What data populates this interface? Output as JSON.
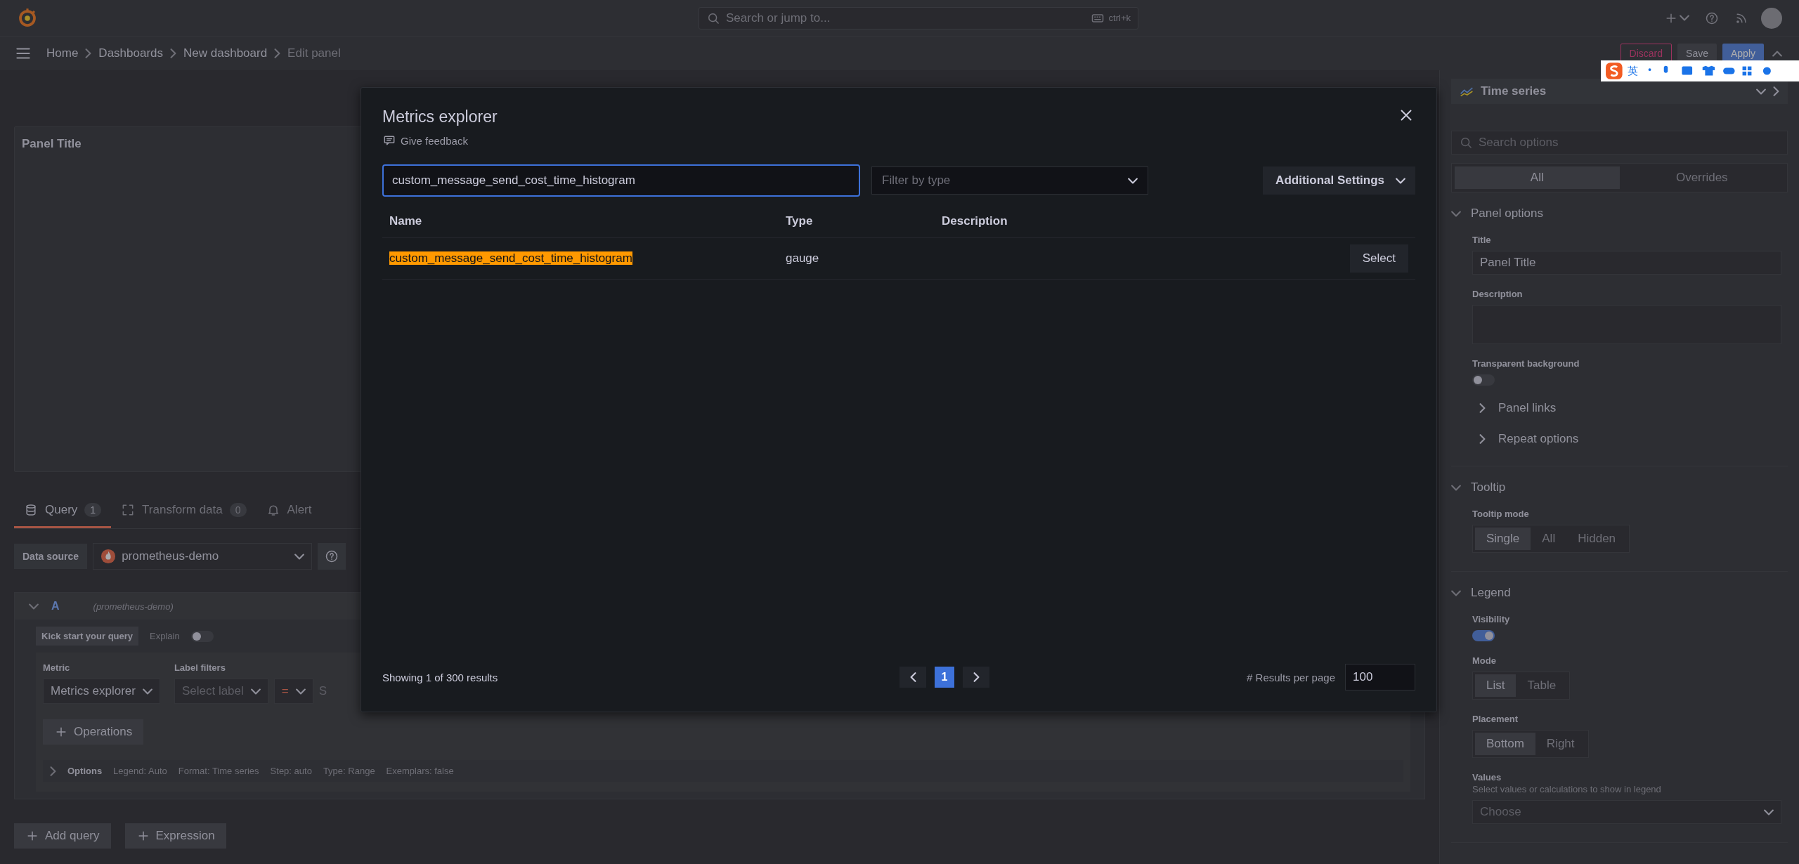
{
  "topbar": {
    "search_placeholder": "Search or jump to...",
    "shortcut": "ctrl+k"
  },
  "breadcrumbs": [
    {
      "label": "Home",
      "current": false
    },
    {
      "label": "Dashboards",
      "current": false
    },
    {
      "label": "New dashboard",
      "current": false
    },
    {
      "label": "Edit panel",
      "current": true
    }
  ],
  "actions": [
    {
      "label": "Discard",
      "kind": "danger"
    },
    {
      "label": "Save",
      "kind": "secondary"
    },
    {
      "label": "Apply",
      "kind": "primary"
    }
  ],
  "ime_toolbar": {
    "label": "英"
  },
  "panel": {
    "title": "Panel Title"
  },
  "query_tabs": [
    {
      "label": "Query",
      "count": "1",
      "selected": true
    },
    {
      "label": "Transform data",
      "count": "0",
      "selected": false
    },
    {
      "label": "Alert",
      "selected": false
    }
  ],
  "data_source": {
    "label": "Data source",
    "value": "prometheus-demo"
  },
  "query": {
    "ref": "A",
    "source": "(prometheus-demo)",
    "kick_start": "Kick start your query",
    "explain": {
      "label": "Explain",
      "on": false
    },
    "metric_label": "Metric",
    "metric_value": "Metrics explorer",
    "label_filters": "Label filters",
    "label_placeholder": "Select label",
    "operator": "=",
    "value_placeholder": "S",
    "operations": "Operations",
    "options_label": "Options",
    "options_items": [
      "Legend: Auto",
      "Format: Time series",
      "Step: auto",
      "Type: Range",
      "Exemplars: false"
    ]
  },
  "bottom_buttons": [
    "Add query",
    "Expression"
  ],
  "options_pane": {
    "visualization": "Time series",
    "search_placeholder": "Search options",
    "tabs": [
      {
        "label": "All",
        "selected": true
      },
      {
        "label": "Overrides",
        "selected": false
      }
    ],
    "sections": [
      {
        "title": "Panel options",
        "expanded": true,
        "fields": [
          {
            "kind": "text",
            "label": "Title",
            "value": "Panel Title"
          },
          {
            "kind": "textarea",
            "label": "Description"
          },
          {
            "kind": "switch",
            "label": "Transparent background",
            "on": false
          },
          {
            "kind": "subsection",
            "label": "Panel links",
            "expanded": false
          },
          {
            "kind": "subsection",
            "label": "Repeat options",
            "expanded": false
          }
        ]
      },
      {
        "title": "Tooltip",
        "expanded": true,
        "fields": [
          {
            "kind": "radio",
            "label": "Tooltip mode",
            "options": [
              {
                "label": "Single",
                "selected": true
              },
              {
                "label": "All",
                "selected": false
              },
              {
                "label": "Hidden",
                "selected": false
              }
            ]
          }
        ]
      },
      {
        "title": "Legend",
        "expanded": true,
        "fields": [
          {
            "kind": "switch",
            "label": "Visibility",
            "on": true
          },
          {
            "kind": "radio",
            "label": "Mode",
            "options": [
              {
                "label": "List",
                "selected": true
              },
              {
                "label": "Table",
                "selected": false
              }
            ]
          },
          {
            "kind": "radio",
            "label": "Placement",
            "options": [
              {
                "label": "Bottom",
                "selected": true
              },
              {
                "label": "Right",
                "selected": false
              }
            ]
          },
          {
            "kind": "select",
            "label": "Values",
            "description": "Select values or calculations to show in legend",
            "placeholder": "Choose"
          }
        ]
      }
    ]
  },
  "modal": {
    "title": "Metrics explorer",
    "feedback": "Give feedback",
    "search_value": "custom_message_send_cost_time_histogram",
    "filter_placeholder": "Filter by type",
    "settings_button": "Additional Settings",
    "columns": [
      "Name",
      "Type",
      "Description"
    ],
    "rows": [
      {
        "name": "custom_message_send_cost_time_histogram",
        "match": true,
        "type": "gauge",
        "action": "Select"
      }
    ],
    "summary": "Showing 1 of 300 results",
    "pages": [
      {
        "label": "1",
        "selected": true
      }
    ],
    "per_page_label": "# Results per page",
    "per_page": "100"
  }
}
